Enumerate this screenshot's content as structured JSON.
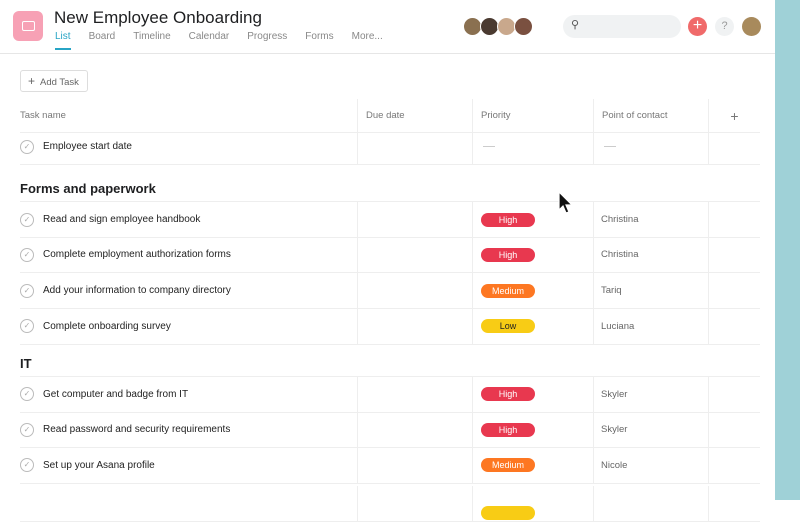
{
  "header": {
    "title": "New Employee Onboarding",
    "tabs": [
      "List",
      "Board",
      "Timeline",
      "Calendar",
      "Progress",
      "Forms",
      "More..."
    ],
    "active_tab": "List"
  },
  "toolbar": {
    "add_task": "Add Task",
    "help": "?",
    "add": "+"
  },
  "columns": {
    "task": "Task name",
    "due": "Due date",
    "priority": "Priority",
    "contact": "Point of contact",
    "add": "+"
  },
  "colors": {
    "High": "#e8384f",
    "Medium": "#fd7722",
    "Low": "#f8cc15",
    "accent": "#27a4c5"
  },
  "top_task": {
    "name": "Employee start date"
  },
  "sections": [
    {
      "title": "Forms and paperwork",
      "tasks": [
        {
          "name": "Read and sign employee handbook",
          "priority": "High",
          "contact": "Christina"
        },
        {
          "name": "Complete employment authorization forms",
          "priority": "High",
          "contact": "Christina"
        },
        {
          "name": "Add your information to company directory",
          "priority": "Medium",
          "contact": "Tariq"
        },
        {
          "name": "Complete onboarding survey",
          "priority": "Low",
          "contact": "Luciana"
        }
      ]
    },
    {
      "title": "IT",
      "tasks": [
        {
          "name": "Get computer and badge from IT",
          "priority": "High",
          "contact": "Skyler"
        },
        {
          "name": "Read password and security requirements",
          "priority": "High",
          "contact": "Skyler"
        },
        {
          "name": "Set up your Asana profile",
          "priority": "Medium",
          "contact": "Nicole"
        }
      ]
    }
  ]
}
